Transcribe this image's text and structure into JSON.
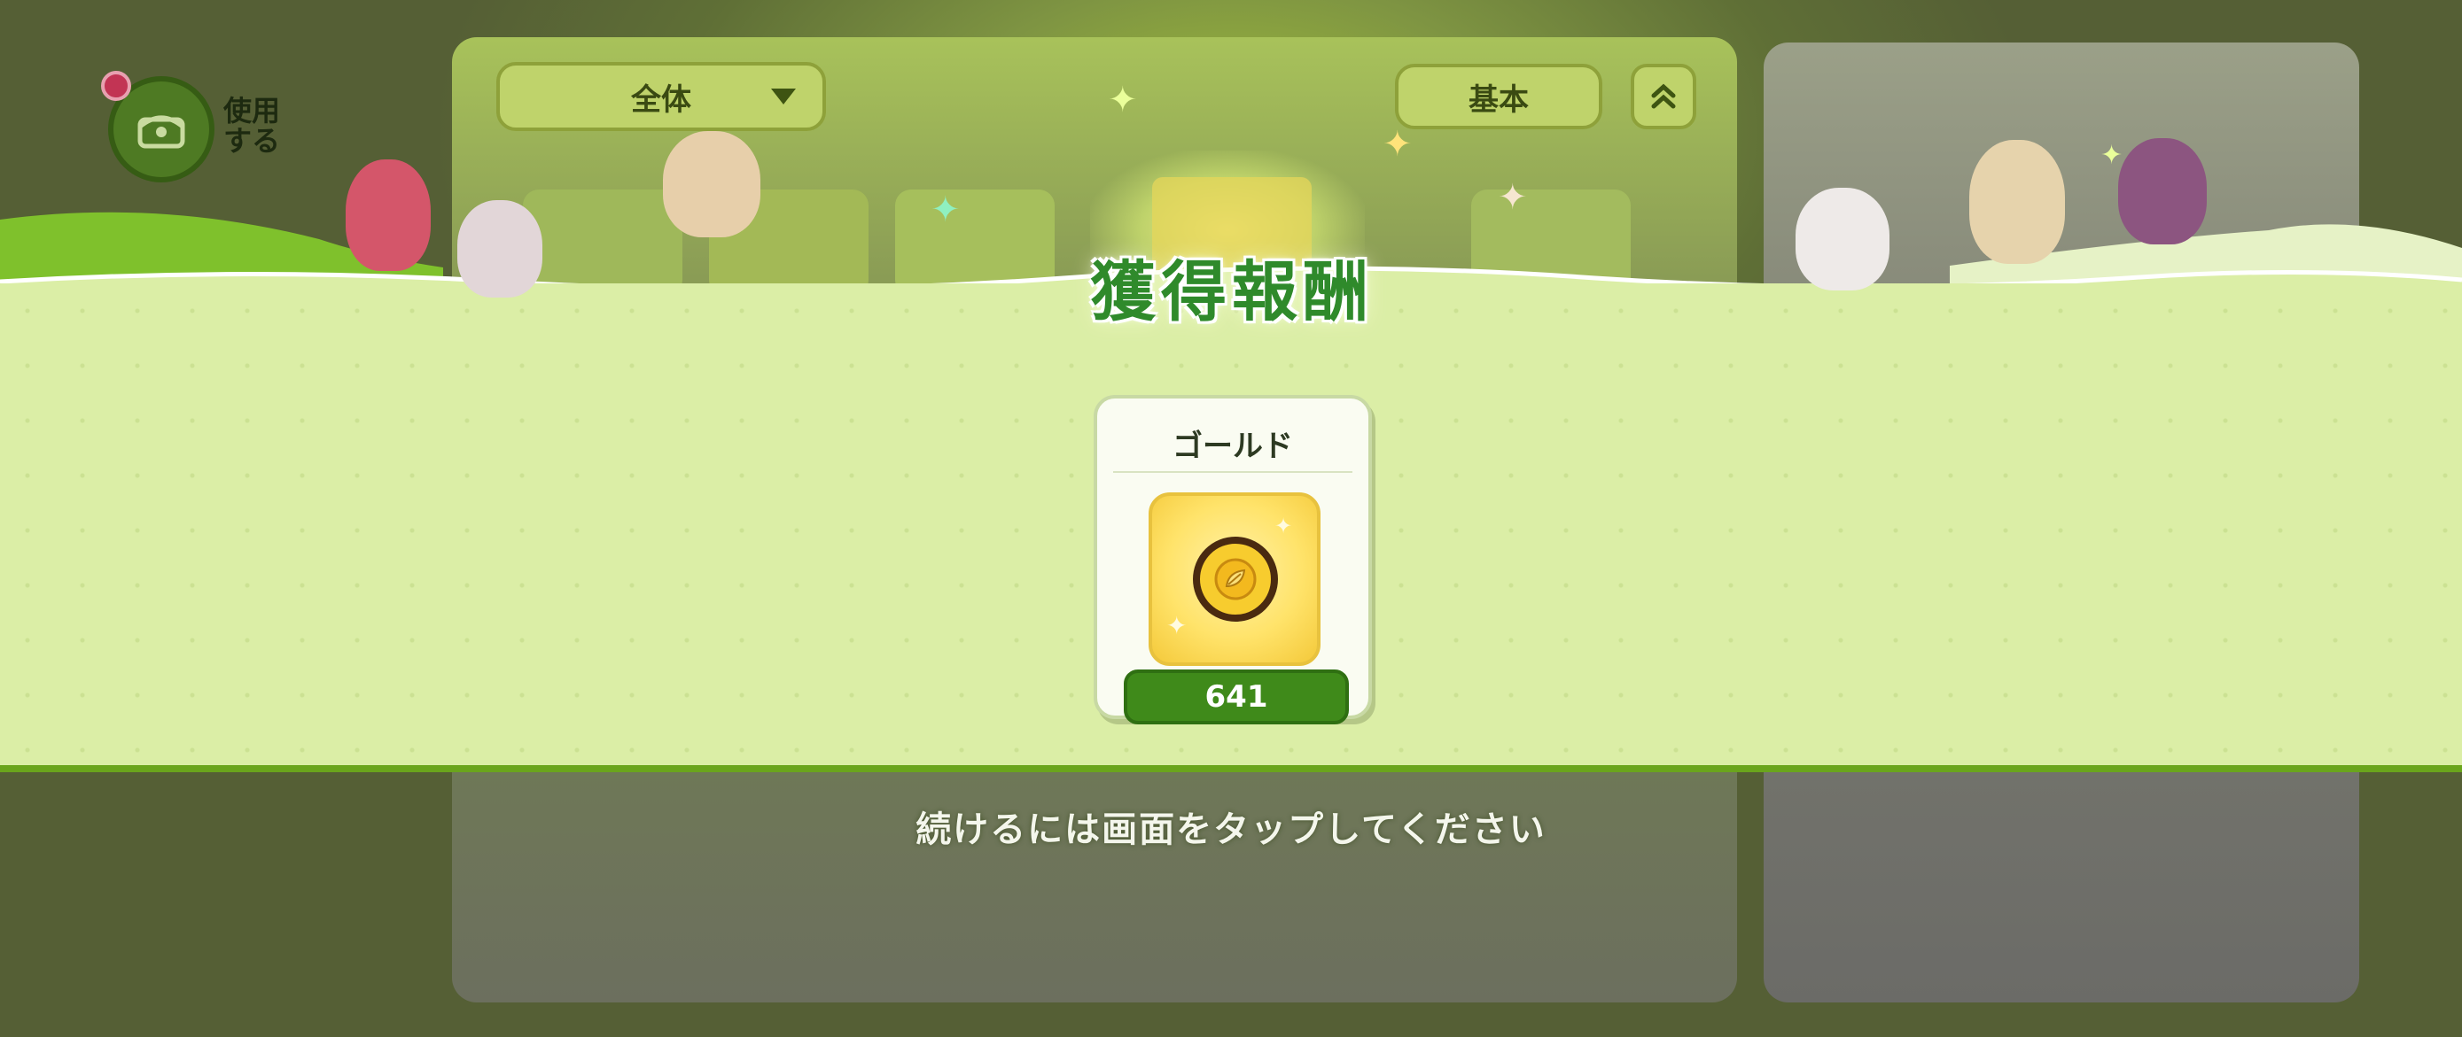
{
  "filter": {
    "selected": "全体"
  },
  "sort": {
    "label": "基本"
  },
  "side_menu": {
    "use_label_line1": "使用",
    "use_label_line2": "する"
  },
  "reward": {
    "title": "獲得報酬",
    "item_name": "ゴールド",
    "item_icon": "gold-coin-icon",
    "quantity": "641"
  },
  "hint": {
    "continue_text": "続けるには画面をタップしてください"
  },
  "colors": {
    "banner": "#dbeea6",
    "accent_green": "#3f8a1a",
    "title_green": "#2f8a2b",
    "coin_gold": "#f7cc2e"
  }
}
